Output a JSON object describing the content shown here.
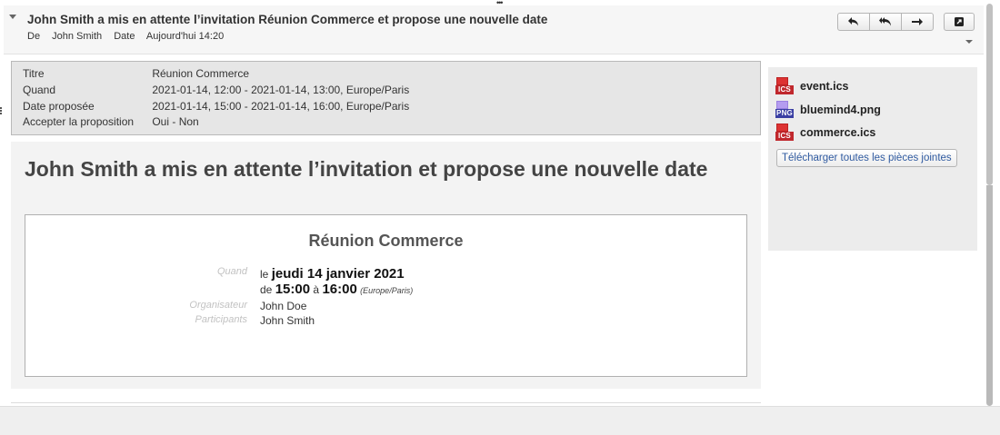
{
  "message": {
    "subject": "John Smith a mis en attente l’invitation Réunion Commerce et propose une nouvelle date",
    "from_label": "De",
    "from_value": "John Smith",
    "date_label": "Date",
    "date_value": "Aujourd'hui 14:20"
  },
  "toolbar": {
    "icons": [
      "reply-icon",
      "reply-all-icon",
      "forward-icon",
      "popout-icon"
    ]
  },
  "details": {
    "title_label": "Titre",
    "title_value": "Réunion Commerce",
    "when_label": "Quand",
    "when_value": "2021-01-14, 12:00 - 2021-01-14, 13:00, Europe/Paris",
    "proposed_label": "Date proposée",
    "proposed_value": "2021-01-14, 15:00 - 2021-01-14, 16:00, Europe/Paris",
    "accept_label": "Accepter la proposition",
    "accept_yes": "Oui",
    "accept_sep": " - ",
    "accept_no": "Non"
  },
  "body": {
    "heading": "John Smith a mis en attente l’invitation et propose une nouvelle date",
    "card": {
      "title": "Réunion Commerce",
      "when_label": "Quand",
      "date_prefix": "le",
      "date_value": "jeudi 14 janvier 2021",
      "from_prefix": "de",
      "start_time": "15:00",
      "to_word": "à",
      "end_time": "16:00",
      "timezone": "(Europe/Paris)",
      "organizer_label": "Organisateur",
      "organizer_value": "John Doe",
      "participants_label": "Participants",
      "participants_value": "John Smith"
    }
  },
  "attachments": {
    "items": [
      {
        "name": "event.ics",
        "type": "ICS",
        "icon": "ics-file-icon"
      },
      {
        "name": "bluemind4.png",
        "type": "PNG",
        "icon": "png-file-icon"
      },
      {
        "name": "commerce.ics",
        "type": "ICS",
        "icon": "ics-file-icon"
      }
    ],
    "download_all": "Télécharger toutes les pièces jointes"
  },
  "colors": {
    "ics": "#c0282d",
    "png": "#3a3fa3",
    "link": "#2f5aa0"
  }
}
